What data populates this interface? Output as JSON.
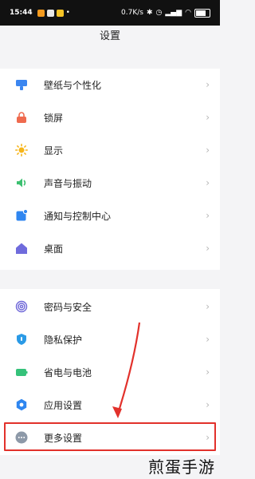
{
  "status_bar": {
    "time": "15:44",
    "speed": "0.7K/s",
    "battery": "83",
    "battery_level_percent": 83
  },
  "header": {
    "title": "设置"
  },
  "settings_groups": [
    {
      "items": [
        {
          "label": "壁纸与个性化",
          "icon": "wallpaper-icon",
          "color": "#3b86f0"
        },
        {
          "label": "锁屏",
          "icon": "lock-icon",
          "color": "#ef6a4e"
        },
        {
          "label": "显示",
          "icon": "sun-icon",
          "color": "#f6b51a"
        },
        {
          "label": "声音与振动",
          "icon": "speaker-icon",
          "color": "#3cc070"
        },
        {
          "label": "通知与控制中心",
          "icon": "notification-icon",
          "color": "#2f86f0"
        },
        {
          "label": "桌面",
          "icon": "home-icon",
          "color": "#6f6bdc"
        }
      ]
    },
    {
      "items": [
        {
          "label": "密码与安全",
          "icon": "fingerprint-icon",
          "color": "#6e67d8"
        },
        {
          "label": "隐私保护",
          "icon": "privacy-shield-icon",
          "color": "#2a9ae6"
        },
        {
          "label": "省电与电池",
          "icon": "battery-icon",
          "color": "#35c27a"
        },
        {
          "label": "应用设置",
          "icon": "gear-icon",
          "color": "#2f86f0"
        },
        {
          "label": "更多设置",
          "icon": "more-dots-icon",
          "color": "#8d99a8"
        }
      ]
    }
  ],
  "watermark": "煎蛋手游"
}
